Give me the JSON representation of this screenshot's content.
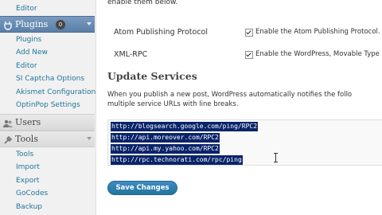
{
  "sidebar": {
    "settings_items_top": [
      {
        "label": "Editor"
      }
    ],
    "plugins": {
      "label": "Plugins",
      "badge": "0",
      "items": [
        {
          "label": "Plugins"
        },
        {
          "label": "Add New"
        },
        {
          "label": "Editor"
        },
        {
          "label": "SI Captcha Options"
        },
        {
          "label": "Akismet Configuration"
        },
        {
          "label": "OptinPop Settings"
        }
      ]
    },
    "users": {
      "label": "Users"
    },
    "tools": {
      "label": "Tools",
      "items": [
        {
          "label": "Tools"
        },
        {
          "label": "Import"
        },
        {
          "label": "Export"
        },
        {
          "label": "GoCodes"
        },
        {
          "label": "Backup"
        }
      ]
    }
  },
  "main": {
    "intro_text": "enable them below.",
    "remote_publishing": [
      {
        "label": "Atom Publishing Protocol",
        "checkbox_label": "Enable the Atom Publishing Protocol.",
        "checked": true
      },
      {
        "label": "XML-RPC",
        "checkbox_label": "Enable the WordPress, Movable Type",
        "checked": true
      }
    ],
    "update_services": {
      "heading": "Update Services",
      "description_line1": "When you publish a new post, WordPress automatically notifies the follo",
      "description_line2": "multiple service URLs with line breaks.",
      "ping_urls": [
        "http://blogsearch.google.com/ping/RPC2",
        "http://api.moreover.com/RPC2",
        "http://api.my.yahoo.com/RPC2",
        "http://rpc.technorati.com/rpc/ping"
      ]
    },
    "save_button_label": "Save Changes"
  },
  "colors": {
    "link": "#21759b",
    "selection": "#0a246a",
    "button": "#21759b",
    "active_menu": "#5a7fa7"
  }
}
